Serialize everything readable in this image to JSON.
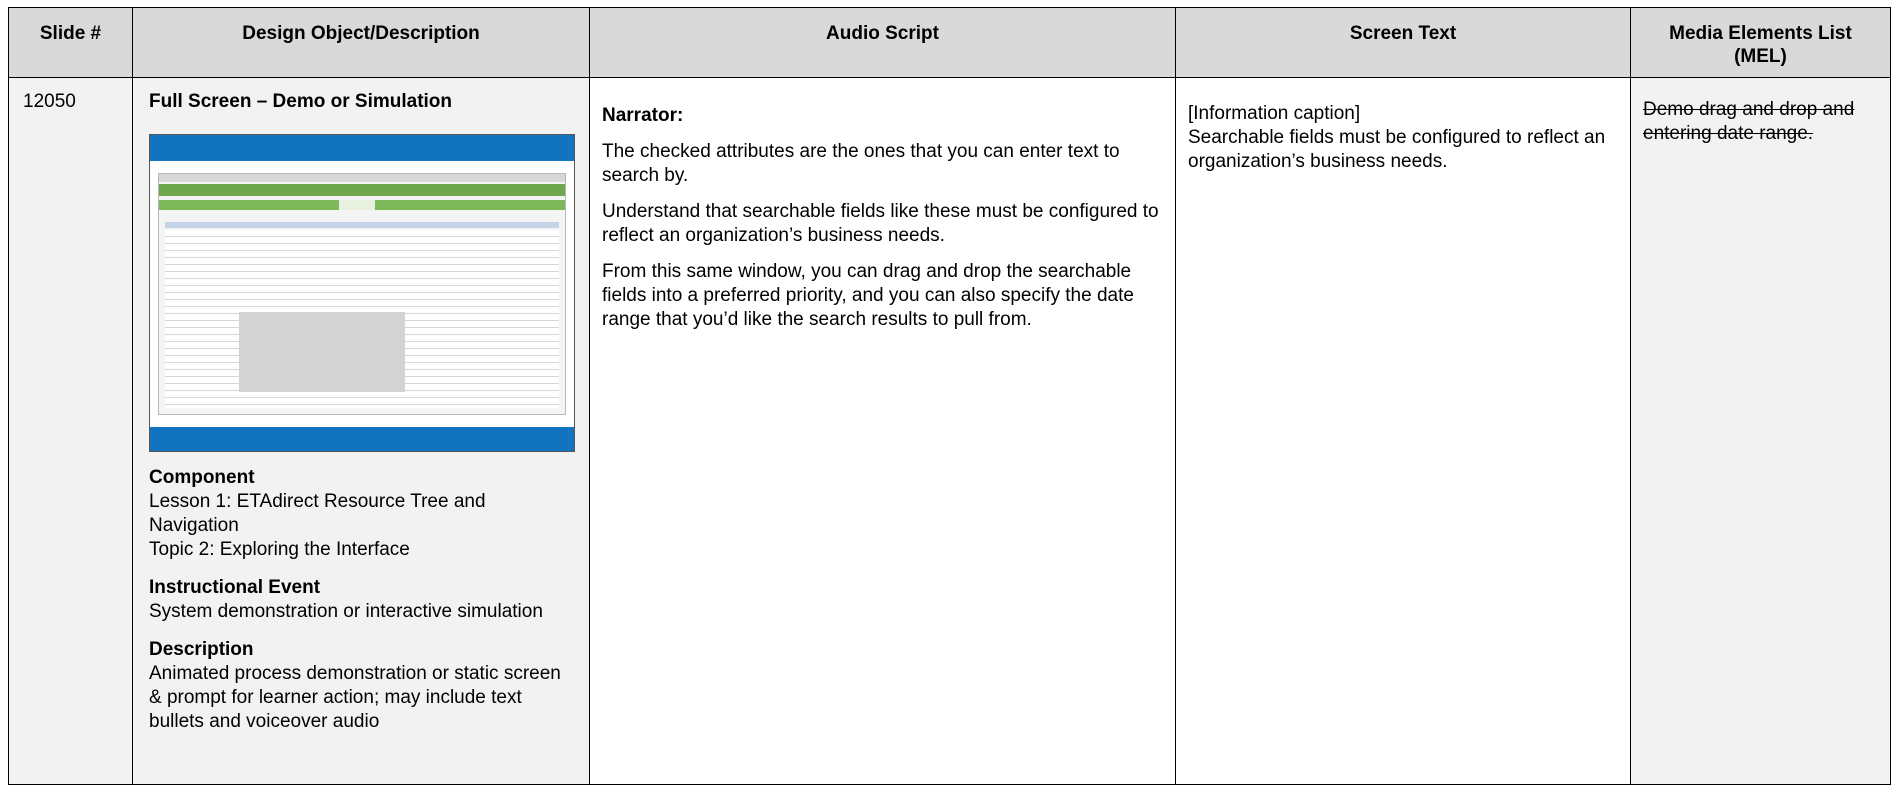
{
  "headers": {
    "slide": "Slide #",
    "design": "Design Object/Description",
    "audio": "Audio Script",
    "screen": "Screen Text",
    "mel": "Media Elements List (MEL)"
  },
  "row": {
    "slide_number": "12050",
    "design": {
      "title": "Full Screen – Demo or Simulation",
      "component_heading": "Component",
      "component_lines": [
        "Lesson 1: ETAdirect Resource Tree and Navigation",
        "Topic 2: Exploring the Interface"
      ],
      "event_heading": "Instructional Event",
      "event_text": "System demonstration or interactive simulation",
      "description_heading": "Description",
      "description_text": "Animated process demonstration or static screen & prompt for learner action; may include text bullets and voiceover audio"
    },
    "audio": {
      "speaker": "Narrator:",
      "paragraphs": [
        "The checked attributes are the ones that you can enter text to search by.",
        "Understand that searchable fields like these must be configured to reflect an organization’s business needs.",
        "From this same window, you can drag and drop the searchable fields into a preferred priority, and you can also specify the date range that you’d like the search results to pull from."
      ]
    },
    "screen": {
      "caption_type": "[Information caption]",
      "caption_text": "Searchable fields must be configured to reflect an organization’s business needs."
    },
    "mel": {
      "text": "Demo drag and drop and entering date range."
    }
  }
}
